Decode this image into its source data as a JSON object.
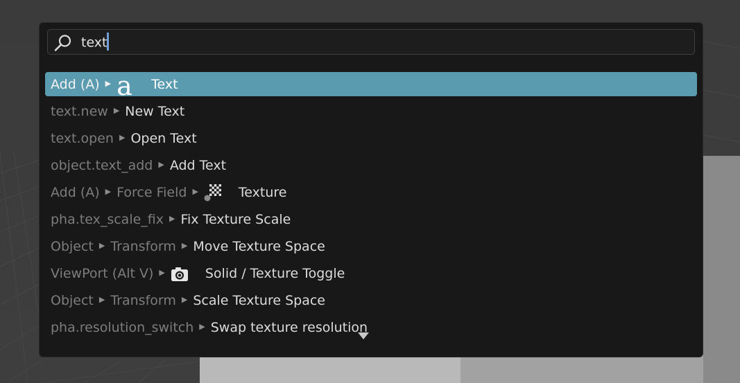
{
  "search": {
    "query": "text"
  },
  "results": [
    {
      "crumbs": [
        "Add (A)"
      ],
      "icon": "text-object-icon",
      "label": "Text",
      "selected": true
    },
    {
      "crumbs": [
        "text.new"
      ],
      "label": "New Text"
    },
    {
      "crumbs": [
        "text.open"
      ],
      "label": "Open Text"
    },
    {
      "crumbs": [
        "object.text_add"
      ],
      "label": "Add Text"
    },
    {
      "crumbs": [
        "Add (A)",
        "Force Field"
      ],
      "icon": "texture-icon",
      "label": "Texture"
    },
    {
      "crumbs": [
        "pha.tex_scale_fix"
      ],
      "label": "Fix Texture Scale"
    },
    {
      "crumbs": [
        "Object",
        "Transform"
      ],
      "label": "Move Texture Space"
    },
    {
      "crumbs": [
        "ViewPort (Alt V)"
      ],
      "icon": "camera-icon",
      "label": "Solid / Texture Toggle"
    },
    {
      "crumbs": [
        "Object",
        "Transform"
      ],
      "label": "Scale Texture Space"
    },
    {
      "crumbs": [
        "pha.resolution_switch"
      ],
      "label": "Swap texture resolution"
    }
  ],
  "icons": {
    "text_glyph": "a"
  },
  "colors": {
    "selected_row": "#5b9bb0",
    "caret": "#6f9ed8",
    "popup_bg": "#181818"
  }
}
